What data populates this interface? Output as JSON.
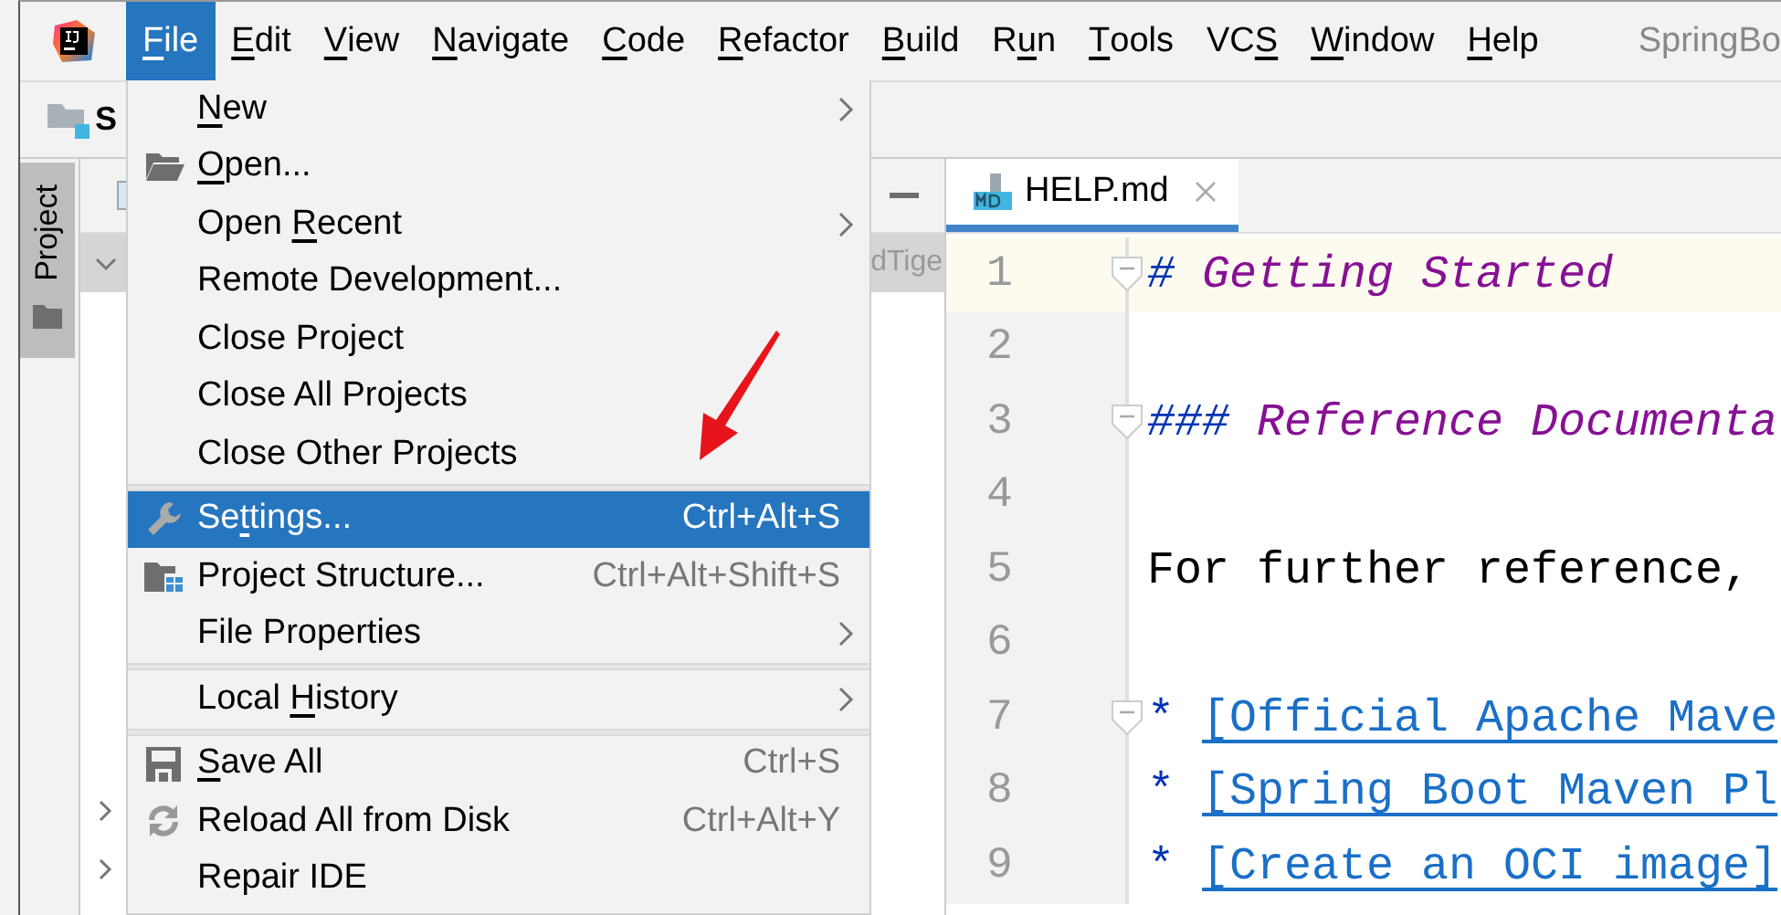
{
  "app_title": "SpringBo",
  "menubar": [
    {
      "key": "F",
      "post": "ile",
      "selected": true
    },
    {
      "key": "E",
      "post": "dit",
      "selected": false
    },
    {
      "key": "V",
      "post": "iew",
      "selected": false
    },
    {
      "key": "N",
      "post": "avigate",
      "selected": false
    },
    {
      "key": "C",
      "post": "ode",
      "selected": false
    },
    {
      "key": "R",
      "post": "efactor",
      "selected": false
    },
    {
      "key": "B",
      "post": "uild",
      "selected": false
    },
    {
      "pre": "R",
      "key": "u",
      "post": "n",
      "selected": false
    },
    {
      "key": "T",
      "post": "ools",
      "selected": false
    },
    {
      "pre": "VC",
      "key": "S",
      "selected": false
    },
    {
      "key": "W",
      "post": "indow",
      "selected": false
    },
    {
      "key": "H",
      "post": "elp",
      "selected": false
    }
  ],
  "toolbar": {
    "project_name": "S"
  },
  "tool_window_tab": {
    "label": "Project",
    "selected": true
  },
  "project_panel": {
    "tree_rows": [
      {
        "text": "dTige",
        "expanded": true,
        "selected": true
      },
      {
        "expanded": false,
        "selected": false
      },
      {
        "expanded": false,
        "selected": false
      }
    ]
  },
  "editor": {
    "tabs": [
      {
        "label": "HELP.md",
        "selected": true
      }
    ],
    "lines": [
      {
        "number": "1",
        "current": true,
        "fold": true,
        "segments": [
          {
            "kind": "mark",
            "text": "#"
          },
          {
            "kind": "heading",
            "text": " Getting Started"
          }
        ]
      },
      {
        "number": "2",
        "current": false,
        "fold": false
      },
      {
        "number": "3",
        "current": false,
        "fold": true,
        "segments": [
          {
            "kind": "mark",
            "text": "###"
          },
          {
            "kind": "heading",
            "text": " Reference Documenta"
          }
        ]
      },
      {
        "number": "4",
        "current": false,
        "fold": false
      },
      {
        "number": "5",
        "current": false,
        "fold": false,
        "segments": [
          {
            "kind": "text",
            "text": "For further reference,"
          }
        ]
      },
      {
        "number": "6",
        "current": false,
        "fold": false
      },
      {
        "number": "7",
        "current": false,
        "fold": true,
        "segments": [
          {
            "kind": "bullet",
            "text": "*"
          },
          {
            "kind": "link",
            "text": "[Official Apache Mave"
          }
        ]
      },
      {
        "number": "8",
        "current": false,
        "fold": false,
        "segments": [
          {
            "kind": "bullet",
            "text": "*"
          },
          {
            "kind": "link",
            "text": "[Spring Boot Maven Pl"
          }
        ]
      },
      {
        "number": "9",
        "current": false,
        "fold": false,
        "segments": [
          {
            "kind": "bullet",
            "text": "*"
          },
          {
            "kind": "link",
            "text": "[Create an OCI image]"
          }
        ]
      }
    ]
  },
  "file_menu": [
    {
      "kind": "item",
      "key": "N",
      "post": "ew",
      "submenu": true,
      "selected": false
    },
    {
      "kind": "item",
      "key": "O",
      "post": "pen...",
      "submenu": false,
      "selected": false
    },
    {
      "kind": "item",
      "pre": "Open ",
      "key": "R",
      "post": "ecent",
      "submenu": true,
      "selected": false
    },
    {
      "kind": "item",
      "label": "Remote Development...",
      "submenu": false,
      "selected": false
    },
    {
      "kind": "item",
      "label": "Close Project",
      "submenu": false,
      "selected": false
    },
    {
      "kind": "item",
      "label": "Close All Projects",
      "submenu": false,
      "selected": false
    },
    {
      "kind": "item",
      "label": "Close Other Projects",
      "submenu": false,
      "selected": false
    },
    {
      "kind": "separator"
    },
    {
      "kind": "item",
      "pre": "Se",
      "key": "t",
      "post": "tings...",
      "shortcut": "Ctrl+Alt+S",
      "submenu": false,
      "selected": true
    },
    {
      "kind": "item",
      "label": "Project Structure...",
      "shortcut": "Ctrl+Alt+Shift+S",
      "submenu": false,
      "selected": false
    },
    {
      "kind": "item",
      "label": "File Properties",
      "submenu": true,
      "selected": false
    },
    {
      "kind": "separator"
    },
    {
      "kind": "item",
      "pre": "Local ",
      "key": "H",
      "post": "istory",
      "submenu": true,
      "selected": false
    },
    {
      "kind": "separator"
    },
    {
      "kind": "item",
      "key": "S",
      "post": "ave All",
      "shortcut": "Ctrl+S",
      "submenu": false,
      "selected": false
    },
    {
      "kind": "item",
      "label": "Reload All from Disk",
      "shortcut": "Ctrl+Alt+Y",
      "submenu": false,
      "selected": false
    },
    {
      "kind": "item",
      "label": "Repair IDE",
      "submenu": false,
      "selected": false
    }
  ]
}
